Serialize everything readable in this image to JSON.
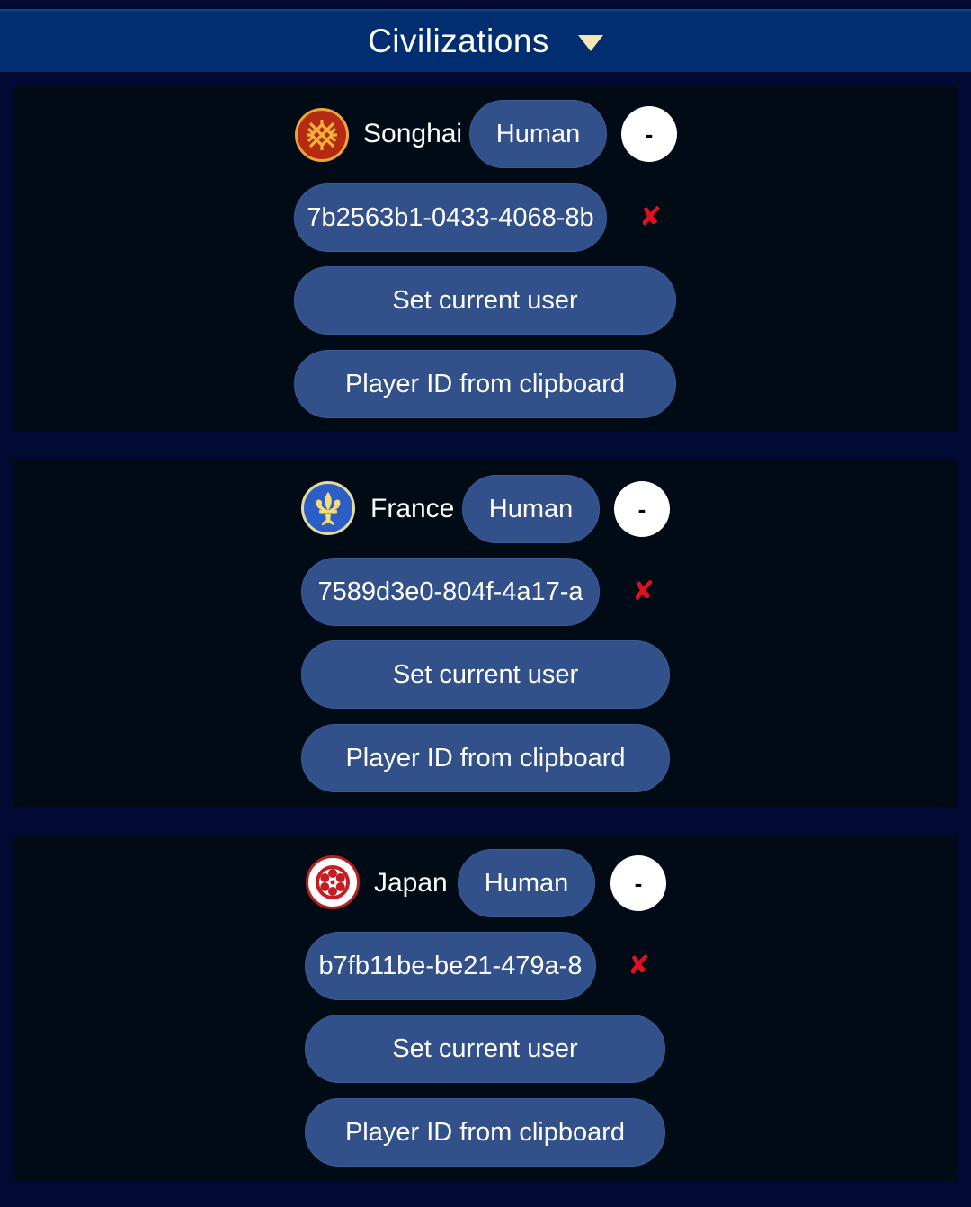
{
  "header": {
    "title": "Civilizations",
    "arrow_color": "#f6e7b4"
  },
  "colors": {
    "page_background": "#000a33",
    "panel_background": "#000b16",
    "button_fill": "#32508a",
    "remove_mark": "#e01020"
  },
  "players": [
    {
      "civ_name": "Songhai",
      "civ_icon": "songhai-emblem-icon",
      "player_type": "Human",
      "remove_label": "-",
      "player_id": "7b2563b1-0433-4068-8b",
      "clear_mark": "✘",
      "set_current_user_label": "Set current user",
      "player_id_from_clipboard_label": "Player ID from clipboard"
    },
    {
      "civ_name": "France",
      "civ_icon": "fleur-de-lis-icon",
      "player_type": "Human",
      "remove_label": "-",
      "player_id": "7589d3e0-804f-4a17-a",
      "clear_mark": "✘",
      "set_current_user_label": "Set current user",
      "player_id_from_clipboard_label": "Player ID from clipboard"
    },
    {
      "civ_name": "Japan",
      "civ_icon": "japan-mon-icon",
      "player_type": "Human",
      "remove_label": "-",
      "player_id": "b7fb11be-be21-479a-8",
      "clear_mark": "✘",
      "set_current_user_label": "Set current user",
      "player_id_from_clipboard_label": "Player ID from clipboard"
    }
  ]
}
